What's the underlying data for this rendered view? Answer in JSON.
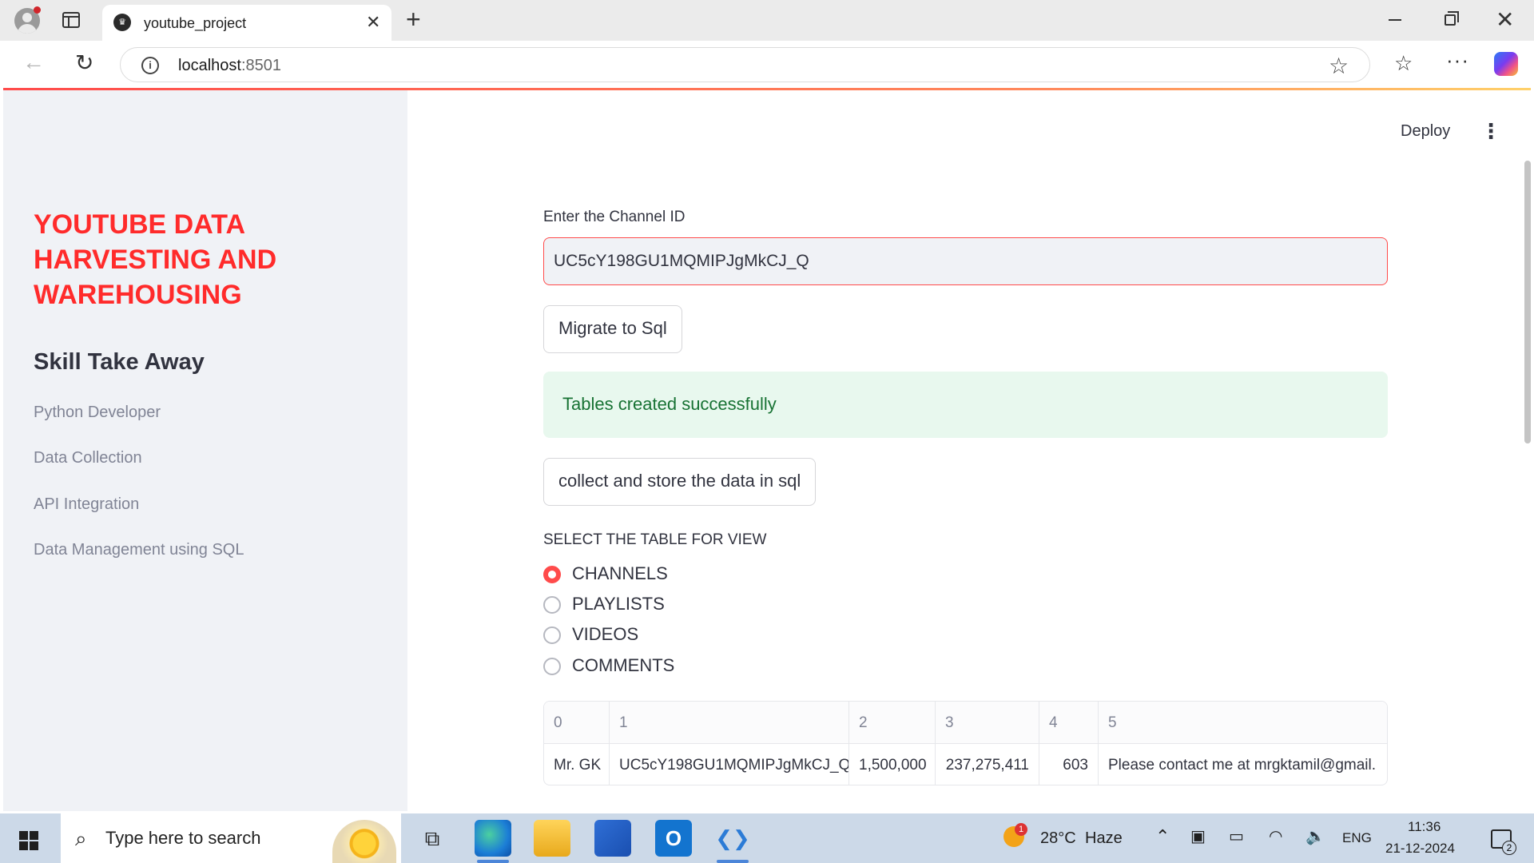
{
  "browser": {
    "tab_title": "youtube_project",
    "url_host": "localhost",
    "url_port": ":8501"
  },
  "sidebar": {
    "app_title": "YOUTUBE DATA HARVESTING AND WAREHOUSING",
    "section_title": "Skill Take Away",
    "items": [
      "Python Developer",
      "Data Collection",
      "API Integration",
      "Data Management using SQL"
    ]
  },
  "header": {
    "deploy_label": "Deploy",
    "menu_glyph": "⋮"
  },
  "form": {
    "channel_label": "Enter the Channel ID",
    "channel_value": "UC5cY198GU1MQMIPJgMkCJ_Q",
    "migrate_button": "Migrate to Sql",
    "success_message": "Tables created successfully",
    "collect_button": "collect and store the data in sql"
  },
  "table_select": {
    "label": "SELECT THE TABLE FOR VIEW",
    "options": [
      "CHANNELS",
      "PLAYLISTS",
      "VIDEOS",
      "COMMENTS"
    ],
    "selected": "CHANNELS"
  },
  "data_table": {
    "headers": [
      "0",
      "1",
      "2",
      "3",
      "4",
      "5"
    ],
    "row": [
      "Mr. GK",
      "UC5cY198GU1MQMIPJgMkCJ_Q",
      "1,500,000",
      "237,275,411",
      "603",
      "Please contact me at mrgktamil@gmail."
    ]
  },
  "taskbar": {
    "search_placeholder": "Type here to search",
    "weather_temp": "28°C",
    "weather_desc": "Haze",
    "badge_weather": "1",
    "language": "ENG",
    "time": "11:36",
    "date": "21-12-2024",
    "notification_count": "2"
  },
  "colors": {
    "accent": "#ff4b4b",
    "success_bg": "#e8f8ee",
    "success_text": "#177233",
    "sidebar_bg": "#f0f2f6"
  }
}
